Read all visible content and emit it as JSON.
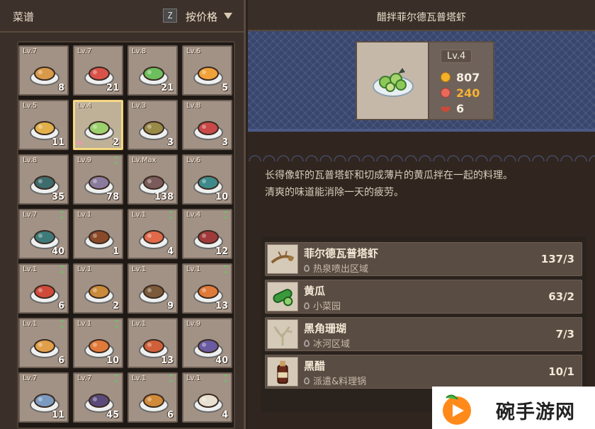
{
  "left": {
    "title": "菜谱",
    "sort_key": "Z",
    "sort_label": "按价格"
  },
  "dishes": [
    {
      "level": "Lv.7",
      "count": "8",
      "up": false,
      "color": "#d89a4a"
    },
    {
      "level": "Lv.7",
      "count": "21",
      "up": false,
      "color": "#d9524a"
    },
    {
      "level": "Lv.8",
      "count": "21",
      "up": false,
      "color": "#6cbf5c"
    },
    {
      "level": "Lv.6",
      "count": "5",
      "up": false,
      "color": "#f0a23a"
    },
    {
      "level": "Lv.5",
      "count": "11",
      "up": false,
      "color": "#e2b04c"
    },
    {
      "level": "Lv.4",
      "count": "2",
      "up": false,
      "color": "#9cd06c",
      "selected": true
    },
    {
      "level": "Lv.3",
      "count": "3",
      "up": false,
      "color": "#9a8a48"
    },
    {
      "level": "Lv.8",
      "count": "3",
      "up": false,
      "color": "#c94848"
    },
    {
      "level": "Lv.8",
      "count": "35",
      "up": false,
      "color": "#3e6b6b"
    },
    {
      "level": "Lv.9",
      "count": "78",
      "up": true,
      "color": "#8a7a9c"
    },
    {
      "level": "Lv.Max",
      "count": "138",
      "up": false,
      "color": "#7a5a5a"
    },
    {
      "level": "Lv.6",
      "count": "10",
      "up": false,
      "color": "#3e8a8a"
    },
    {
      "level": "Lv.7",
      "count": "40",
      "up": true,
      "color": "#3e7a7a"
    },
    {
      "level": "Lv.1",
      "count": "1",
      "up": false,
      "color": "#8a4a2a"
    },
    {
      "level": "Lv.1",
      "count": "4",
      "up": true,
      "color": "#e06a4a"
    },
    {
      "level": "Lv.4",
      "count": "12",
      "up": true,
      "color": "#a03a3a"
    },
    {
      "level": "Lv.1",
      "count": "6",
      "up": true,
      "color": "#d04a3a"
    },
    {
      "level": "Lv.1",
      "count": "2",
      "up": false,
      "color": "#c98a3a"
    },
    {
      "level": "Lv.1",
      "count": "9",
      "up": false,
      "color": "#7a5a3a"
    },
    {
      "level": "Lv.1",
      "count": "13",
      "up": true,
      "color": "#e07a3a"
    },
    {
      "level": "Lv.1",
      "count": "6",
      "up": true,
      "color": "#e0a04a"
    },
    {
      "level": "Lv.1",
      "count": "10",
      "up": true,
      "color": "#e07a3a"
    },
    {
      "level": "Lv.1",
      "count": "13",
      "up": false,
      "color": "#d0603a"
    },
    {
      "level": "Lv.9",
      "count": "40",
      "up": false,
      "color": "#6a5aa0"
    },
    {
      "level": "Lv.7",
      "count": "11",
      "up": false,
      "color": "#7a9ac0"
    },
    {
      "level": "Lv.7",
      "count": "45",
      "up": true,
      "color": "#5a4a7a"
    },
    {
      "level": "Lv.1",
      "count": "6",
      "up": true,
      "color": "#d08a3a"
    },
    {
      "level": "Lv.1",
      "count": "4",
      "up": true,
      "color": "#e8e0d0"
    }
  ],
  "detail": {
    "title": "醋拌菲尔德瓦普塔虾",
    "level": "Lv.4",
    "sell_price": "807",
    "rating": "240",
    "portions": "6",
    "description": "长得像虾的瓦普塔虾和切成薄片的黄瓜拌在一起的料理。\n清爽的味道能消除一天的疲劳。",
    "description_line1": "长得像虾的瓦普塔虾和切成薄片的黄瓜拌在一起的料理。",
    "description_line2": "清爽的味道能消除一天的疲劳。"
  },
  "ingredients": [
    {
      "name": "菲尔德瓦普塔虾",
      "location": "热泉喷出区域",
      "qty": "137/3",
      "icon": "shrimp-icon",
      "color": "#a07a40"
    },
    {
      "name": "黄瓜",
      "location": "小菜园",
      "qty": "63/2",
      "icon": "cucumber-icon",
      "color": "#3a9a3a"
    },
    {
      "name": "黑角珊瑚",
      "location": "冰河区域",
      "qty": "7/3",
      "icon": "coral-icon",
      "color": "#c8c0a0"
    },
    {
      "name": "黑醋",
      "location": "派遣&料理锅",
      "qty": "10/1",
      "icon": "vinegar-icon",
      "color": "#6a2a1a"
    }
  ],
  "watermark": {
    "text": "碗手游网"
  }
}
